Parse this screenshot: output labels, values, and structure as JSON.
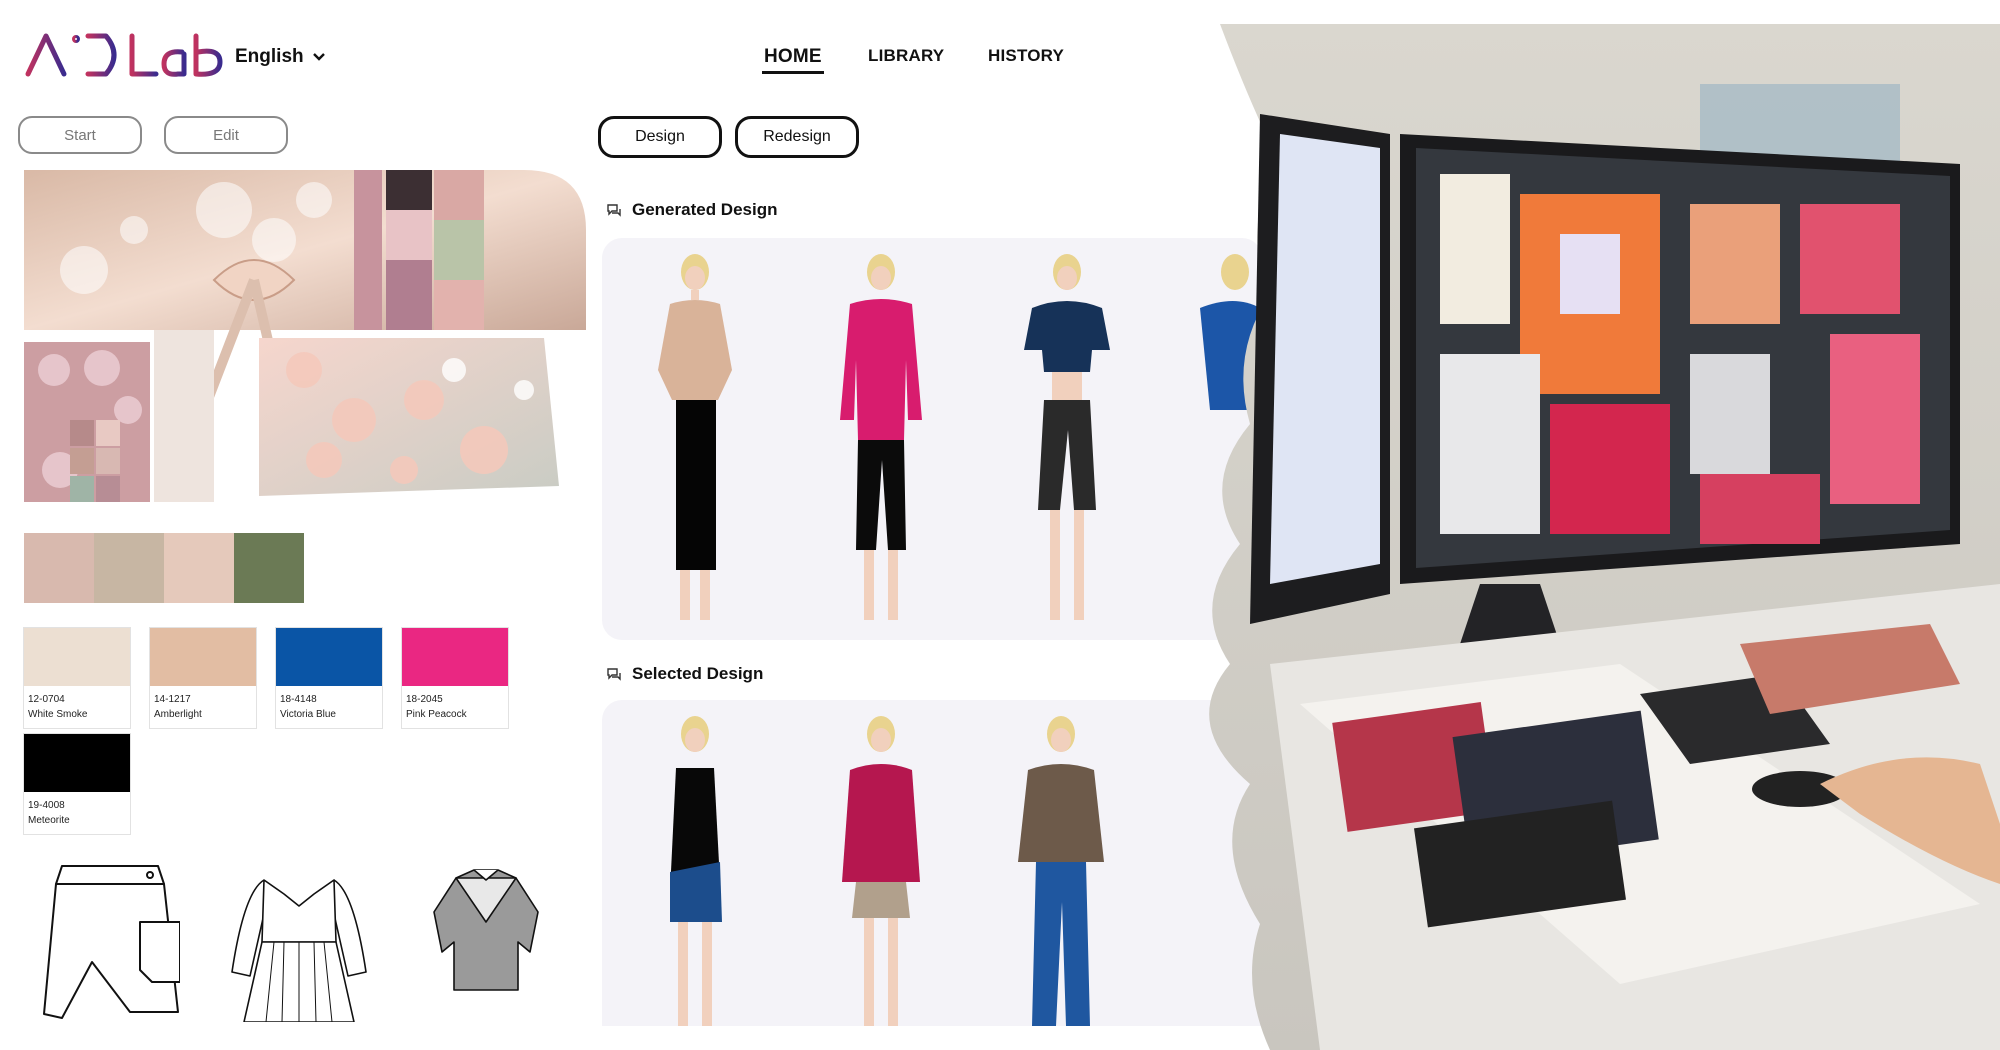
{
  "header": {
    "language": "English",
    "nav": [
      {
        "label": "HOME",
        "active": true
      },
      {
        "label": "LIBRARY",
        "active": false
      },
      {
        "label": "HISTORY",
        "active": false
      }
    ]
  },
  "left_toolbar": {
    "start_label": "Start",
    "edit_label": "Edit"
  },
  "center_toolbar": {
    "design_label": "Design",
    "redesign_label": "Redesign"
  },
  "generated_section": {
    "title": "Generated Design"
  },
  "selected_section": {
    "title": "Selected Design"
  },
  "swatches": [
    {
      "code": "12-0704",
      "name": "White Smoke",
      "color": "#ecdfd2"
    },
    {
      "code": "14-1217",
      "name": "Amberlight",
      "color": "#e2bda3"
    },
    {
      "code": "18-4148",
      "name": "Victoria Blue",
      "color": "#0a55a6"
    },
    {
      "code": "18-2045",
      "name": "Pink Peacock",
      "color": "#ea2782"
    },
    {
      "code": "19-4008",
      "name": "Meteorite",
      "color": "#000000"
    }
  ],
  "colors": {
    "logo_gradient_start": "#c0325f",
    "logo_gradient_end": "#3a2b8e",
    "panel_bg": "#f4f3f8"
  },
  "icons": [
    "chevron-down-icon",
    "chat-bubble-icon"
  ]
}
